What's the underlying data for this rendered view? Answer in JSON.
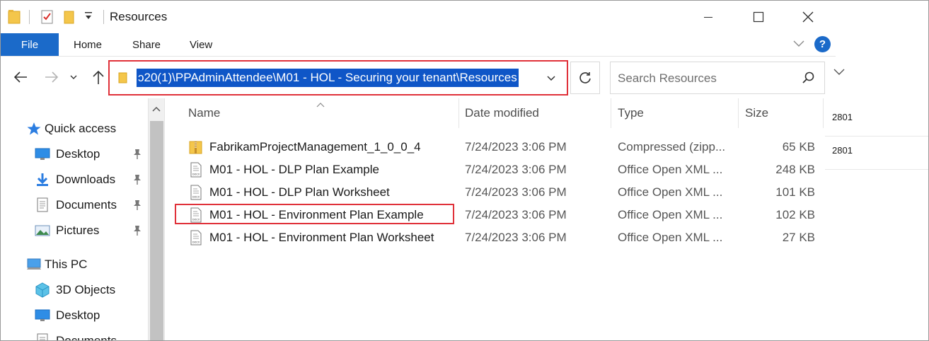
{
  "window": {
    "title": "Resources"
  },
  "ribbon": {
    "tabs": [
      {
        "label": "File"
      },
      {
        "label": "Home"
      },
      {
        "label": "Share"
      },
      {
        "label": "View"
      }
    ],
    "help_label": "?"
  },
  "address": {
    "path": "ɔ20(1)\\PPAdminAttendee\\M01 - HOL - Securing your tenant\\Resources"
  },
  "search": {
    "placeholder": "Search Resources"
  },
  "sidebar": {
    "items": [
      {
        "label": "Quick access",
        "icon": "star-icon"
      },
      {
        "label": "Desktop",
        "icon": "desktop-icon",
        "pinned": true
      },
      {
        "label": "Downloads",
        "icon": "download-icon",
        "pinned": true
      },
      {
        "label": "Documents",
        "icon": "documents-icon",
        "pinned": true
      },
      {
        "label": "Pictures",
        "icon": "pictures-icon",
        "pinned": true
      },
      {
        "label": "This PC",
        "icon": "pc-icon"
      },
      {
        "label": "3D Objects",
        "icon": "cube-icon"
      },
      {
        "label": "Desktop",
        "icon": "desktop-icon"
      },
      {
        "label": "Documents",
        "icon": "documents-icon"
      }
    ]
  },
  "filelist": {
    "columns": {
      "name": "Name",
      "date": "Date modified",
      "type": "Type",
      "size": "Size"
    },
    "rows": [
      {
        "name": "FabrikamProjectManagement_1_0_0_4",
        "date": "7/24/2023 3:06 PM",
        "type": "Compressed (zipp...",
        "size": "65 KB",
        "icon": "zip-folder-icon"
      },
      {
        "name": "M01 - HOL - DLP Plan Example",
        "date": "7/24/2023 3:06 PM",
        "type": "Office Open XML ...",
        "size": "248 KB",
        "icon": "docx-icon"
      },
      {
        "name": "M01 - HOL - DLP Plan Worksheet",
        "date": "7/24/2023 3:06 PM",
        "type": "Office Open XML ...",
        "size": "101 KB",
        "icon": "docx-icon"
      },
      {
        "name": "M01 - HOL - Environment Plan Example",
        "date": "7/24/2023 3:06 PM",
        "type": "Office Open XML ...",
        "size": "102 KB",
        "icon": "docx-icon"
      },
      {
        "name": "M01 - HOL - Environment Plan Worksheet",
        "date": "7/24/2023 3:06 PM",
        "type": "Office Open XML ...",
        "size": "27 KB",
        "icon": "docx-icon"
      }
    ]
  },
  "background_window": {
    "rows": [
      "2801",
      "2801"
    ]
  },
  "colors": {
    "accent": "#1b6ac9",
    "selection": "#0f56c7",
    "highlight_outline": "#e0313a"
  }
}
